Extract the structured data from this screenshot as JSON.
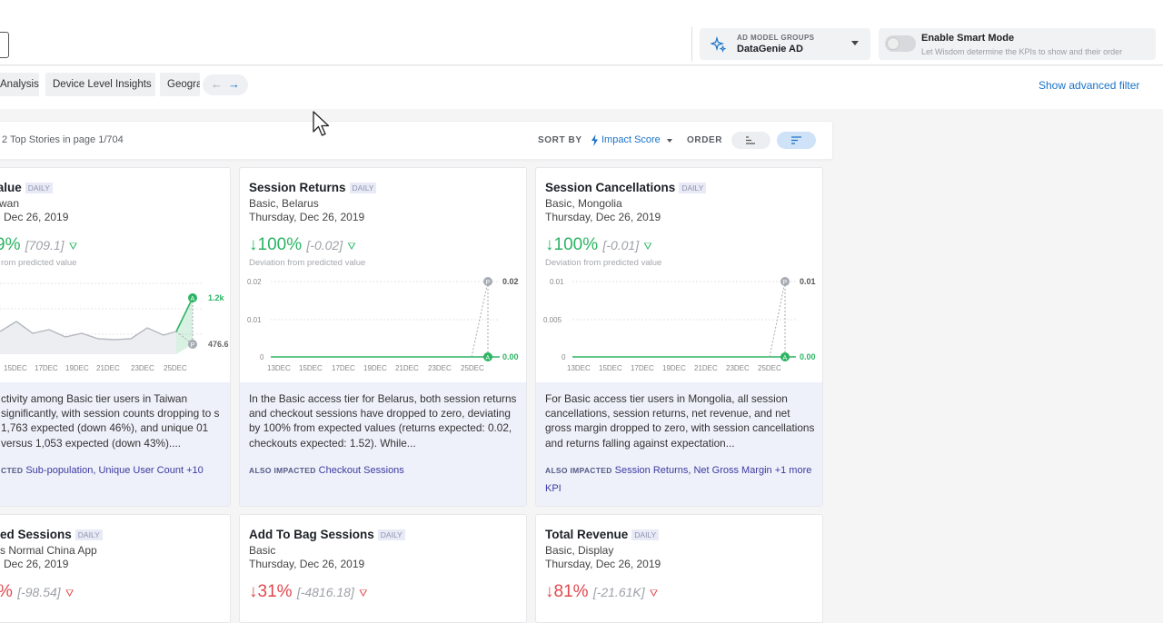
{
  "header": {
    "model_groups_caption": "AD MODEL GROUPS",
    "model_groups_value": "DataGenie AD",
    "smart_mode_title": "Enable Smart Mode",
    "smart_mode_desc": "Let Wisdom determine the KPIs to show and their order",
    "smart_mode_on": false
  },
  "tabs": [
    "Analysis",
    "Device Level Insights",
    "Geogra"
  ],
  "tab_arrows": {
    "prev": "←",
    "next": "→"
  },
  "advanced_filter": "Show advanced filter",
  "sortbar": {
    "count_text": "2 Top Stories in page 1/704",
    "sort_by_label": "SORT BY",
    "sort_value": "Impact Score",
    "order_label": "ORDER",
    "order_selected": "descending"
  },
  "colors": {
    "accent": "#1a73c8",
    "positive": "#2bb463",
    "negative": "#e0484e",
    "summary_bg": "#eef1fa"
  },
  "cards": [
    {
      "title": "Order Value",
      "freq": "DAILY",
      "segment": "wan",
      "date": "Dec 26, 2019",
      "direction": "up",
      "deviation": "9%",
      "delta": "[709.1]",
      "deviation_label": "rom predicted value",
      "chart": {
        "x_ticks": [
          "15DEC",
          "17DEC",
          "19DEC",
          "21DEC",
          "23DEC",
          "25DEC"
        ],
        "actual_label": "1.2k",
        "predicted_label": "476.6"
      },
      "summary": "ctivity among Basic tier users in Taiwan significantly, with session counts dropping to s 1,763 expected (down 46%), and unique 01 versus 1,053 expected (down 43%)....",
      "also_label": "CTED",
      "also_text": "Sub-population, Unique User Count +10"
    },
    {
      "title": "Session Returns",
      "freq": "DAILY",
      "segment": "Basic, Belarus",
      "date": "Thursday, Dec 26, 2019",
      "direction": "down",
      "deviation": "100%",
      "delta": "[-0.02]",
      "deviation_label": "Deviation from predicted value",
      "chart": {
        "type": "line",
        "y_ticks": [
          "0.02",
          "0.01",
          "0"
        ],
        "ylim": [
          0,
          0.02
        ],
        "x_ticks": [
          "13DEC",
          "15DEC",
          "17DEC",
          "19DEC",
          "21DEC",
          "23DEC",
          "25DEC"
        ],
        "predicted_label": "0.02",
        "actual_label": "0.00"
      },
      "summary": "In the Basic access tier for Belarus, both session returns and checkout sessions have dropped to zero, deviating by 100% from expected values (returns expected: 0.02, checkouts expected: 1.52). While...",
      "also_label": "ALSO IMPACTED",
      "also_text": "Checkout Sessions"
    },
    {
      "title": "Session Cancellations",
      "freq": "DAILY",
      "segment": "Basic, Mongolia",
      "date": "Thursday, Dec 26, 2019",
      "direction": "down",
      "deviation": "100%",
      "delta": "[-0.01]",
      "deviation_label": "Deviation from predicted value",
      "chart": {
        "type": "line",
        "y_ticks": [
          "0.01",
          "0.005",
          "0"
        ],
        "ylim": [
          0,
          0.01
        ],
        "x_ticks": [
          "13DEC",
          "15DEC",
          "17DEC",
          "19DEC",
          "21DEC",
          "23DEC",
          "25DEC"
        ],
        "predicted_label": "0.01",
        "actual_label": "0.00"
      },
      "summary": "For Basic access tier users in Mongolia, all session cancellations, session returns, net revenue, and net gross margin dropped to zero, with session cancellations and returns falling against expectation...",
      "also_label": "ALSO IMPACTED",
      "also_text": "Session Returns, Net Gross Margin +1 more KPI"
    },
    {
      "title": "ed Sessions",
      "freq": "DAILY",
      "segment": "s Normal China App",
      "date": "Dec 26, 2019",
      "direction": "down",
      "deviation": "%",
      "delta": "[-98.54]"
    },
    {
      "title": "Add To Bag Sessions",
      "freq": "DAILY",
      "segment": "Basic",
      "date": "Thursday, Dec 26, 2019",
      "direction": "down",
      "deviation": "31%",
      "delta": "[-4816.18]"
    },
    {
      "title": "Total Revenue",
      "freq": "DAILY",
      "segment": "Basic, Display",
      "date": "Thursday, Dec 26, 2019",
      "direction": "down",
      "deviation": "81%",
      "delta": "[-21.61K]"
    }
  ]
}
